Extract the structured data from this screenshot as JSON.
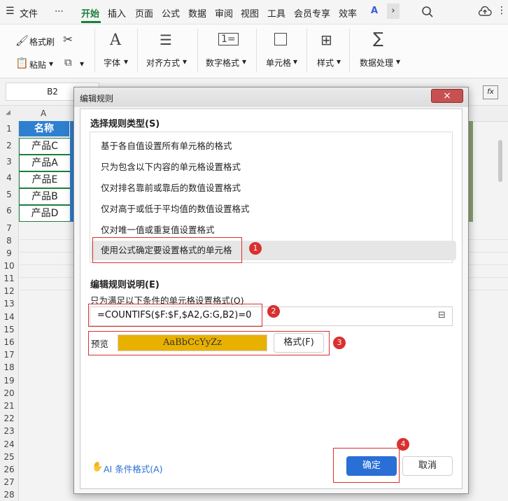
{
  "menu": {
    "file": "文件",
    "more": "⋯",
    "tabs": [
      "开始",
      "插入",
      "页面",
      "公式",
      "数据",
      "审阅",
      "视图",
      "工具",
      "会员专享",
      "效率"
    ],
    "active_tab": "开始"
  },
  "ribbon": {
    "format_painter": "格式刷",
    "paste": "粘贴",
    "font": "字体",
    "alignment": "对齐方式",
    "number_format": "数字格式",
    "cell": "单元格",
    "style": "样式",
    "data_processing": "数据处理"
  },
  "formula_bar": {
    "cell_ref": "B2",
    "fx": "fx"
  },
  "sheet": {
    "col_a": "A",
    "header": "名称",
    "rows": [
      "产品C",
      "产品A",
      "产品E",
      "产品B",
      "产品D"
    ],
    "row_numbers": [
      "1",
      "2",
      "3",
      "4",
      "5",
      "6",
      "7",
      "8",
      "9",
      "10",
      "11",
      "12",
      "13",
      "14",
      "15",
      "16",
      "17",
      "18",
      "19",
      "20",
      "21",
      "22",
      "23",
      "24",
      "25",
      "26",
      "27",
      "28"
    ]
  },
  "dialog": {
    "title": "编辑规则",
    "close": "×",
    "select_rule_type": "选择规则类型(S)",
    "rule_types": [
      "基于各自值设置所有单元格的格式",
      "只为包含以下内容的单元格设置格式",
      "仅对排名靠前或靠后的数值设置格式",
      "仅对高于或低于平均值的数值设置格式",
      "仅对唯一值或重复值设置格式",
      "使用公式确定要设置格式的单元格"
    ],
    "selected_rule": 5,
    "edit_description": "编辑规则说明(E)",
    "condition_label": "只为满足以下条件的单元格设置格式(O)",
    "formula": "=COUNTIFS($F:$F,$A2,G:G,B2)=0",
    "preview_label": "预览",
    "preview_text": "AaBbCcYyZz",
    "preview_color": "#e8b100",
    "format_button": "格式(F)",
    "ai_label": "AI 条件格式(A)",
    "ok": "确定",
    "cancel": "取消"
  },
  "badges": [
    "1",
    "2",
    "3",
    "4"
  ]
}
